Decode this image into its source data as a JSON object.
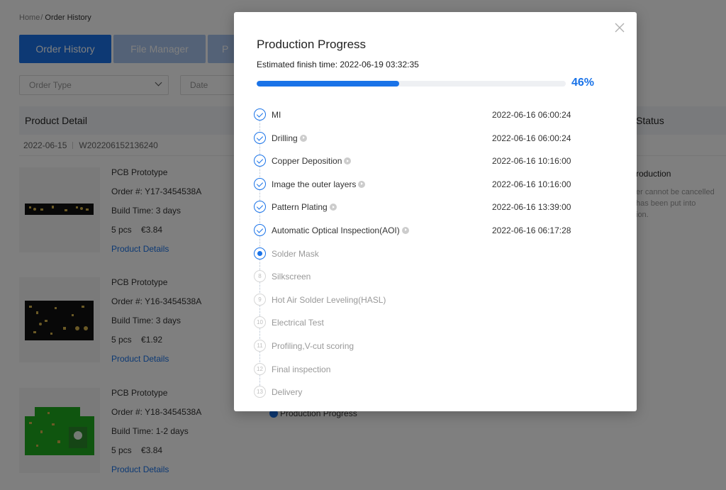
{
  "breadcrumb": {
    "home": "Home",
    "separator": "/",
    "current": "Order History"
  },
  "tabs": [
    {
      "label": "Order History",
      "active": true
    },
    {
      "label": "File Manager",
      "active": false
    },
    {
      "label": "P",
      "active": false
    }
  ],
  "filters": {
    "order_type_placeholder": "Order Type",
    "date_placeholder": "Date"
  },
  "table": {
    "product_header": "Product Detail",
    "status_header": "Status"
  },
  "order": {
    "date": "2022-06-15",
    "number": "W202206152136240"
  },
  "products": [
    {
      "name": "PCB Prototype",
      "order_no": "Order #: Y17-3454538A",
      "build_time": "Build Time: 3 days",
      "qty": "5 pcs",
      "price": "€3.84",
      "link": "Product Details"
    },
    {
      "name": "PCB Prototype",
      "order_no": "Order #: Y16-3454538A",
      "build_time": "Build Time: 3 days",
      "qty": "5 pcs",
      "price": "€1.92",
      "link": "Product Details"
    },
    {
      "name": "PCB Prototype",
      "order_no": "Order #: Y18-3454538A",
      "build_time": "Build Time: 1-2 days",
      "qty": "5 pcs",
      "price": "€3.84",
      "link": "Product Details"
    }
  ],
  "status_col": {
    "title": "roduction",
    "line1": "er cannot be cancelled",
    "line2": "has been put into",
    "line3": "ion."
  },
  "under_modal_status": "Production Progress",
  "modal": {
    "title": "Production Progress",
    "eta": "Estimated finish time: 2022-06-19 03:32:35",
    "progress": 46,
    "progress_label": "46%",
    "steps": [
      {
        "num": "1",
        "name": "MI",
        "time": "2022-06-16 06:00:24",
        "state": "done",
        "has_play": false
      },
      {
        "num": "2",
        "name": "Drilling",
        "time": "2022-06-16 06:00:24",
        "state": "done",
        "has_play": true
      },
      {
        "num": "3",
        "name": "Copper Deposition",
        "time": "2022-06-16 10:16:00",
        "state": "done",
        "has_play": true
      },
      {
        "num": "4",
        "name": "Image the outer layers",
        "time": "2022-06-16 10:16:00",
        "state": "done",
        "has_play": true
      },
      {
        "num": "5",
        "name": "Pattern Plating",
        "time": "2022-06-16 13:39:00",
        "state": "done",
        "has_play": true
      },
      {
        "num": "6",
        "name": "Automatic Optical Inspection(AOI)",
        "time": "2022-06-16 06:17:28",
        "state": "done",
        "has_play": true
      },
      {
        "num": "7",
        "name": "Solder Mask",
        "time": "",
        "state": "current",
        "has_play": false
      },
      {
        "num": "8",
        "name": "Silkscreen",
        "time": "",
        "state": "pending",
        "has_play": false
      },
      {
        "num": "9",
        "name": "Hot Air Solder Leveling(HASL)",
        "time": "",
        "state": "pending",
        "has_play": false
      },
      {
        "num": "10",
        "name": "Electrical Test",
        "time": "",
        "state": "pending",
        "has_play": false
      },
      {
        "num": "11",
        "name": "Profiling,V-cut scoring",
        "time": "",
        "state": "pending",
        "has_play": false
      },
      {
        "num": "12",
        "name": "Final inspection",
        "time": "",
        "state": "pending",
        "has_play": false
      },
      {
        "num": "13",
        "name": "Delivery",
        "time": "",
        "state": "pending",
        "has_play": false
      }
    ]
  },
  "colors": {
    "accent": "#1a73e8",
    "overlay": "#000000"
  }
}
